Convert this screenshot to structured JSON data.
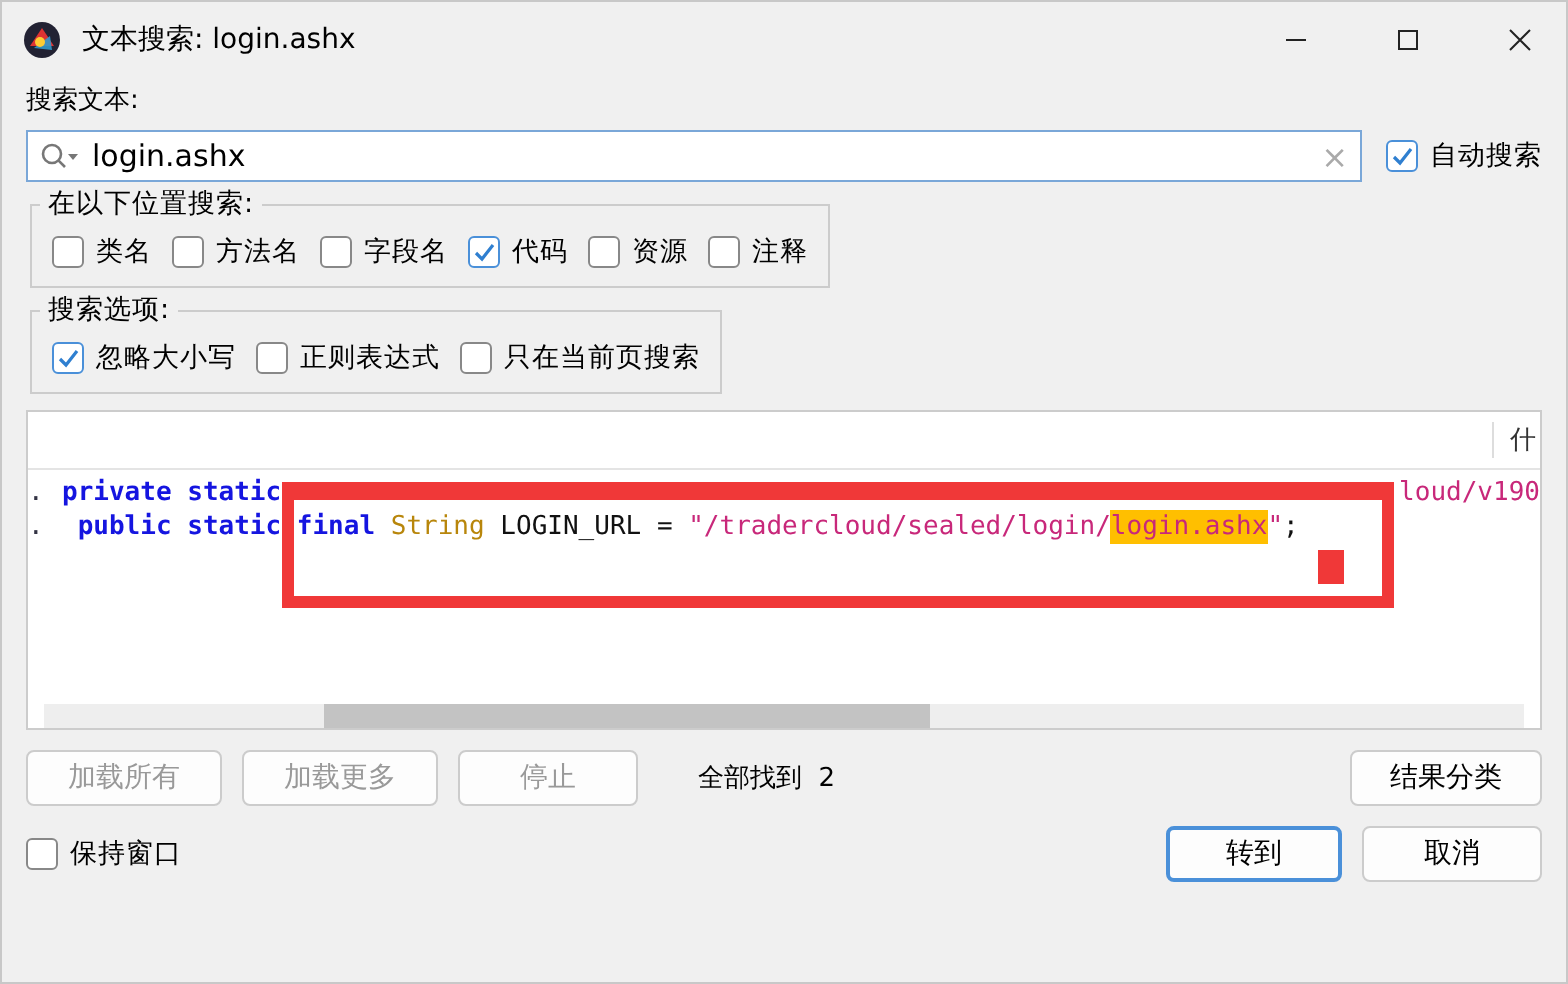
{
  "window": {
    "title": "文本搜索: login.ashx"
  },
  "search": {
    "label": "搜索文本:",
    "value": "login.ashx",
    "clear": "×"
  },
  "auto_search": {
    "label": "自动搜索",
    "checked": true
  },
  "location_group": {
    "title": "在以下位置搜索:",
    "options": [
      {
        "label": "类名",
        "checked": false
      },
      {
        "label": "方法名",
        "checked": false
      },
      {
        "label": "字段名",
        "checked": false
      },
      {
        "label": "代码",
        "checked": true
      },
      {
        "label": "资源",
        "checked": false
      },
      {
        "label": "注释",
        "checked": false
      }
    ]
  },
  "options_group": {
    "title": "搜索选项:",
    "options": [
      {
        "label": "忽略大小写",
        "checked": true
      },
      {
        "label": "正则表达式",
        "checked": false
      },
      {
        "label": "只在当前页搜索",
        "checked": false
      }
    ]
  },
  "results": {
    "columns": [
      "什"
    ],
    "rows": [
      {
        "marker": ".",
        "tokens": [
          {
            "kind": "keyword",
            "text": "private static"
          },
          {
            "kind": "string",
            "text": "loud/v190",
            "push": true
          }
        ]
      },
      {
        "marker": ".",
        "tokens": [
          {
            "kind": "keyword",
            "text": " public static "
          },
          {
            "kind": "keyword",
            "text": "final "
          },
          {
            "kind": "type",
            "text": "String "
          },
          {
            "kind": "plain",
            "text": "LOGIN_URL = "
          },
          {
            "kind": "string",
            "text": "\"/tradercloud/sealed/login/"
          },
          {
            "kind": "match",
            "text": "login.ashx"
          },
          {
            "kind": "string",
            "text": "\""
          },
          {
            "kind": "plain",
            "text": ";"
          }
        ]
      }
    ]
  },
  "actions": [
    {
      "label": "加载所有",
      "disabled": true
    },
    {
      "label": "加载更多",
      "disabled": true
    },
    {
      "label": "停止",
      "disabled": true
    }
  ],
  "found": {
    "label": "全部找到",
    "count": "2"
  },
  "classify_button": {
    "label": "结果分类"
  },
  "keep_window": {
    "label": "保持窗口",
    "checked": false
  },
  "goto_button": {
    "label": "转到",
    "default": true
  },
  "cancel_button": {
    "label": "取消",
    "default": false
  }
}
